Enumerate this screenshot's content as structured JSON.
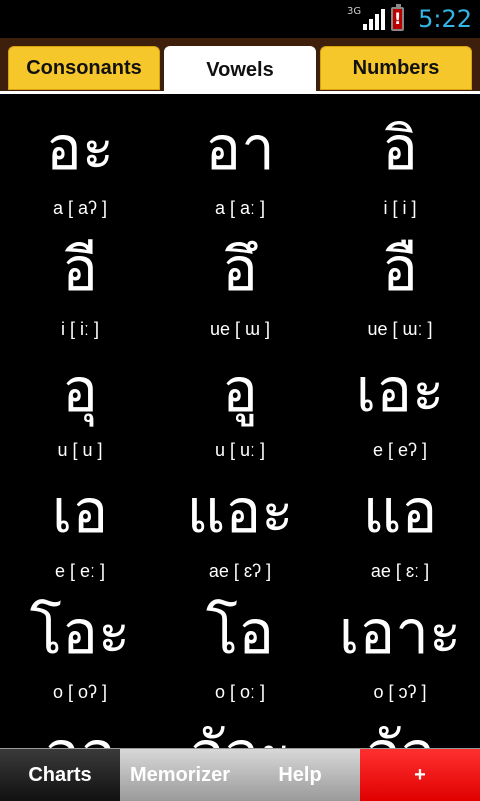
{
  "status": {
    "network": "3G",
    "time": "5:22",
    "battery_alert": "!"
  },
  "tabs": [
    {
      "label": "Consonants",
      "active": false
    },
    {
      "label": "Vowels",
      "active": true
    },
    {
      "label": "Numbers",
      "active": false
    }
  ],
  "vowels": [
    {
      "thai": "อะ",
      "roman": "a [ aʔ ]"
    },
    {
      "thai": "อา",
      "roman": "a [ aː ]"
    },
    {
      "thai": "อิ",
      "roman": "i [ i ]"
    },
    {
      "thai": "อี",
      "roman": "i [ iː ]"
    },
    {
      "thai": "อึ",
      "roman": "ue [ ɯ ]"
    },
    {
      "thai": "อื",
      "roman": "ue [ ɯː ]"
    },
    {
      "thai": "อุ",
      "roman": "u [ u ]"
    },
    {
      "thai": "อู",
      "roman": "u [ uː ]"
    },
    {
      "thai": "เอะ",
      "roman": "e [ eʔ ]"
    },
    {
      "thai": "เอ",
      "roman": "e [ eː ]"
    },
    {
      "thai": "แอะ",
      "roman": "ae [ ɛʔ ]"
    },
    {
      "thai": "แอ",
      "roman": "ae [ ɛː ]"
    },
    {
      "thai": "โอะ",
      "roman": "o [ oʔ ]"
    },
    {
      "thai": "โอ",
      "roman": "o [ oː ]"
    },
    {
      "thai": "เอาะ",
      "roman": "o [ ɔʔ ]"
    },
    {
      "thai": "ออ",
      "roman": ""
    },
    {
      "thai": "อัวะ",
      "roman": ""
    },
    {
      "thai": "อัว",
      "roman": ""
    }
  ],
  "bottom_tabs": [
    {
      "label": "Charts"
    },
    {
      "label": "Memorizer"
    },
    {
      "label": "Help"
    },
    {
      "label": "+"
    }
  ]
}
